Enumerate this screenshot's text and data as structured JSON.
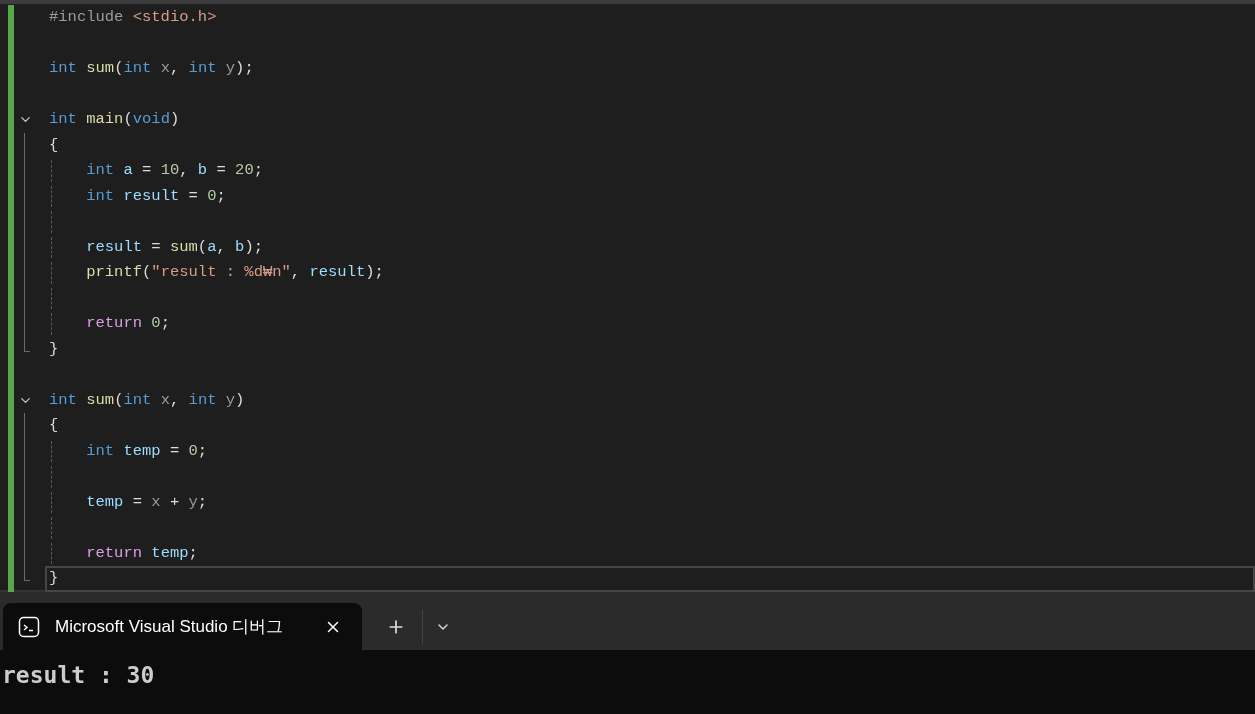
{
  "editor": {
    "lines": [
      {
        "kind": "code",
        "current": false,
        "indented": false,
        "tokens": [
          {
            "kind": "pre",
            "text": "#include "
          },
          {
            "kind": "str",
            "text": "<stdio.h>"
          }
        ]
      },
      {
        "kind": "blank",
        "current": false
      },
      {
        "kind": "code",
        "current": false,
        "indented": false,
        "tokens": [
          {
            "kind": "kw",
            "text": "int "
          },
          {
            "kind": "fn",
            "text": "sum"
          },
          {
            "kind": "plain",
            "text": "("
          },
          {
            "kind": "kw",
            "text": "int "
          },
          {
            "kind": "param",
            "text": "x"
          },
          {
            "kind": "plain",
            "text": ", "
          },
          {
            "kind": "kw",
            "text": "int "
          },
          {
            "kind": "param",
            "text": "y"
          },
          {
            "kind": "plain",
            "text": ");"
          }
        ]
      },
      {
        "kind": "blank",
        "current": false
      },
      {
        "kind": "block",
        "current": false,
        "indented": false,
        "expanded": true,
        "tokens": [
          {
            "kind": "kw",
            "text": "int "
          },
          {
            "kind": "fn",
            "text": "main"
          },
          {
            "kind": "plain",
            "text": "("
          },
          {
            "kind": "kw",
            "text": "void"
          },
          {
            "kind": "plain",
            "text": ")"
          }
        ],
        "children": [
          {
            "kind": "code",
            "current": false,
            "indented": false,
            "tokens": [
              {
                "kind": "plain",
                "text": "{"
              }
            ]
          },
          {
            "kind": "code",
            "current": false,
            "indented": true,
            "tokens": [
              {
                "kind": "kw",
                "text": "int "
              },
              {
                "kind": "var",
                "text": "a"
              },
              {
                "kind": "plain",
                "text": " = "
              },
              {
                "kind": "num",
                "text": "10"
              },
              {
                "kind": "plain",
                "text": ", "
              },
              {
                "kind": "var",
                "text": "b"
              },
              {
                "kind": "plain",
                "text": " = "
              },
              {
                "kind": "num",
                "text": "20"
              },
              {
                "kind": "plain",
                "text": ";"
              }
            ]
          },
          {
            "kind": "code",
            "current": false,
            "indented": true,
            "tokens": [
              {
                "kind": "kw",
                "text": "int "
              },
              {
                "kind": "var",
                "text": "result"
              },
              {
                "kind": "plain",
                "text": " = "
              },
              {
                "kind": "num",
                "text": "0"
              },
              {
                "kind": "plain",
                "text": ";"
              }
            ]
          },
          {
            "kind": "blank",
            "current": false
          },
          {
            "kind": "code",
            "current": false,
            "indented": true,
            "tokens": [
              {
                "kind": "var",
                "text": "result"
              },
              {
                "kind": "plain",
                "text": " = "
              },
              {
                "kind": "fn",
                "text": "sum"
              },
              {
                "kind": "plain",
                "text": "("
              },
              {
                "kind": "var",
                "text": "a"
              },
              {
                "kind": "plain",
                "text": ", "
              },
              {
                "kind": "var",
                "text": "b"
              },
              {
                "kind": "plain",
                "text": ");"
              }
            ]
          },
          {
            "kind": "code",
            "current": false,
            "indented": true,
            "tokens": [
              {
                "kind": "fn",
                "text": "printf"
              },
              {
                "kind": "plain",
                "text": "("
              },
              {
                "kind": "str",
                "text": "\"result : %d₩n\""
              },
              {
                "kind": "plain",
                "text": ", "
              },
              {
                "kind": "var",
                "text": "result"
              },
              {
                "kind": "plain",
                "text": ");"
              }
            ]
          },
          {
            "kind": "blank",
            "current": false
          },
          {
            "kind": "code",
            "current": false,
            "indented": true,
            "tokens": [
              {
                "kind": "ctl",
                "text": "return "
              },
              {
                "kind": "num",
                "text": "0"
              },
              {
                "kind": "plain",
                "text": ";"
              }
            ]
          },
          {
            "kind": "code",
            "current": false,
            "indented": false,
            "tokens": [
              {
                "kind": "plain",
                "text": "}"
              }
            ]
          }
        ]
      },
      {
        "kind": "blank",
        "current": false
      },
      {
        "kind": "block",
        "current": false,
        "indented": false,
        "expanded": true,
        "tokens": [
          {
            "kind": "kw",
            "text": "int "
          },
          {
            "kind": "fn",
            "text": "sum"
          },
          {
            "kind": "plain",
            "text": "("
          },
          {
            "kind": "kw",
            "text": "int "
          },
          {
            "kind": "param",
            "text": "x"
          },
          {
            "kind": "plain",
            "text": ", "
          },
          {
            "kind": "kw",
            "text": "int "
          },
          {
            "kind": "param",
            "text": "y"
          },
          {
            "kind": "plain",
            "text": ")"
          }
        ],
        "children": [
          {
            "kind": "code",
            "current": false,
            "indented": false,
            "tokens": [
              {
                "kind": "plain",
                "text": "{"
              }
            ]
          },
          {
            "kind": "code",
            "current": false,
            "indented": true,
            "tokens": [
              {
                "kind": "kw",
                "text": "int "
              },
              {
                "kind": "var",
                "text": "temp"
              },
              {
                "kind": "plain",
                "text": " = "
              },
              {
                "kind": "num",
                "text": "0"
              },
              {
                "kind": "plain",
                "text": ";"
              }
            ]
          },
          {
            "kind": "blank",
            "current": false
          },
          {
            "kind": "code",
            "current": false,
            "indented": true,
            "tokens": [
              {
                "kind": "var",
                "text": "temp"
              },
              {
                "kind": "plain",
                "text": " = "
              },
              {
                "kind": "param",
                "text": "x"
              },
              {
                "kind": "plain",
                "text": " + "
              },
              {
                "kind": "param",
                "text": "y"
              },
              {
                "kind": "plain",
                "text": ";"
              }
            ]
          },
          {
            "kind": "blank",
            "current": false
          },
          {
            "kind": "code",
            "current": false,
            "indented": true,
            "tokens": [
              {
                "kind": "ctl",
                "text": "return "
              },
              {
                "kind": "var",
                "text": "temp"
              },
              {
                "kind": "plain",
                "text": ";"
              }
            ]
          },
          {
            "kind": "code",
            "current": true,
            "indented": false,
            "tokens": [
              {
                "kind": "plain",
                "text": "}"
              }
            ]
          }
        ]
      }
    ]
  },
  "terminal": {
    "tabs": [
      {
        "title": "Microsoft Visual Studio 디버그",
        "selected": true
      }
    ],
    "output": [
      "result : 30"
    ]
  }
}
